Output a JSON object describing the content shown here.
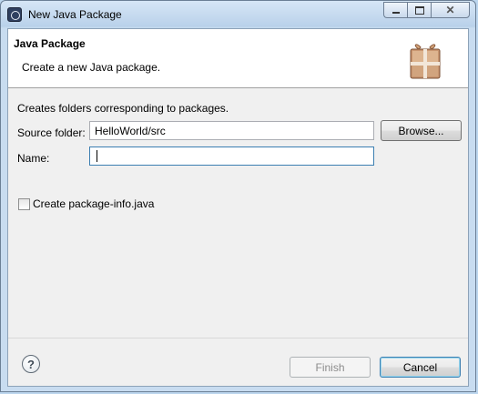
{
  "window": {
    "title": "New Java Package",
    "controls": {
      "minimize": "minimize-icon",
      "maximize": "maximize-icon",
      "close": "close-icon"
    }
  },
  "header": {
    "title": "Java Package",
    "description": "Create a new Java package.",
    "icon": "package-icon"
  },
  "form": {
    "info": "Creates folders corresponding to packages.",
    "source_folder": {
      "label": "Source folder:",
      "value": "HelloWorld/src",
      "browse_label": "Browse..."
    },
    "name": {
      "label": "Name:",
      "value": ""
    },
    "package_info": {
      "label": "Create package-info.java",
      "checked": false
    }
  },
  "footer": {
    "help_icon": "help-icon",
    "help_glyph": "?",
    "finish_label": "Finish",
    "cancel_label": "Cancel"
  },
  "colors": {
    "accent": "#3c7fb1",
    "dialog_background": "#f0f0f0"
  }
}
